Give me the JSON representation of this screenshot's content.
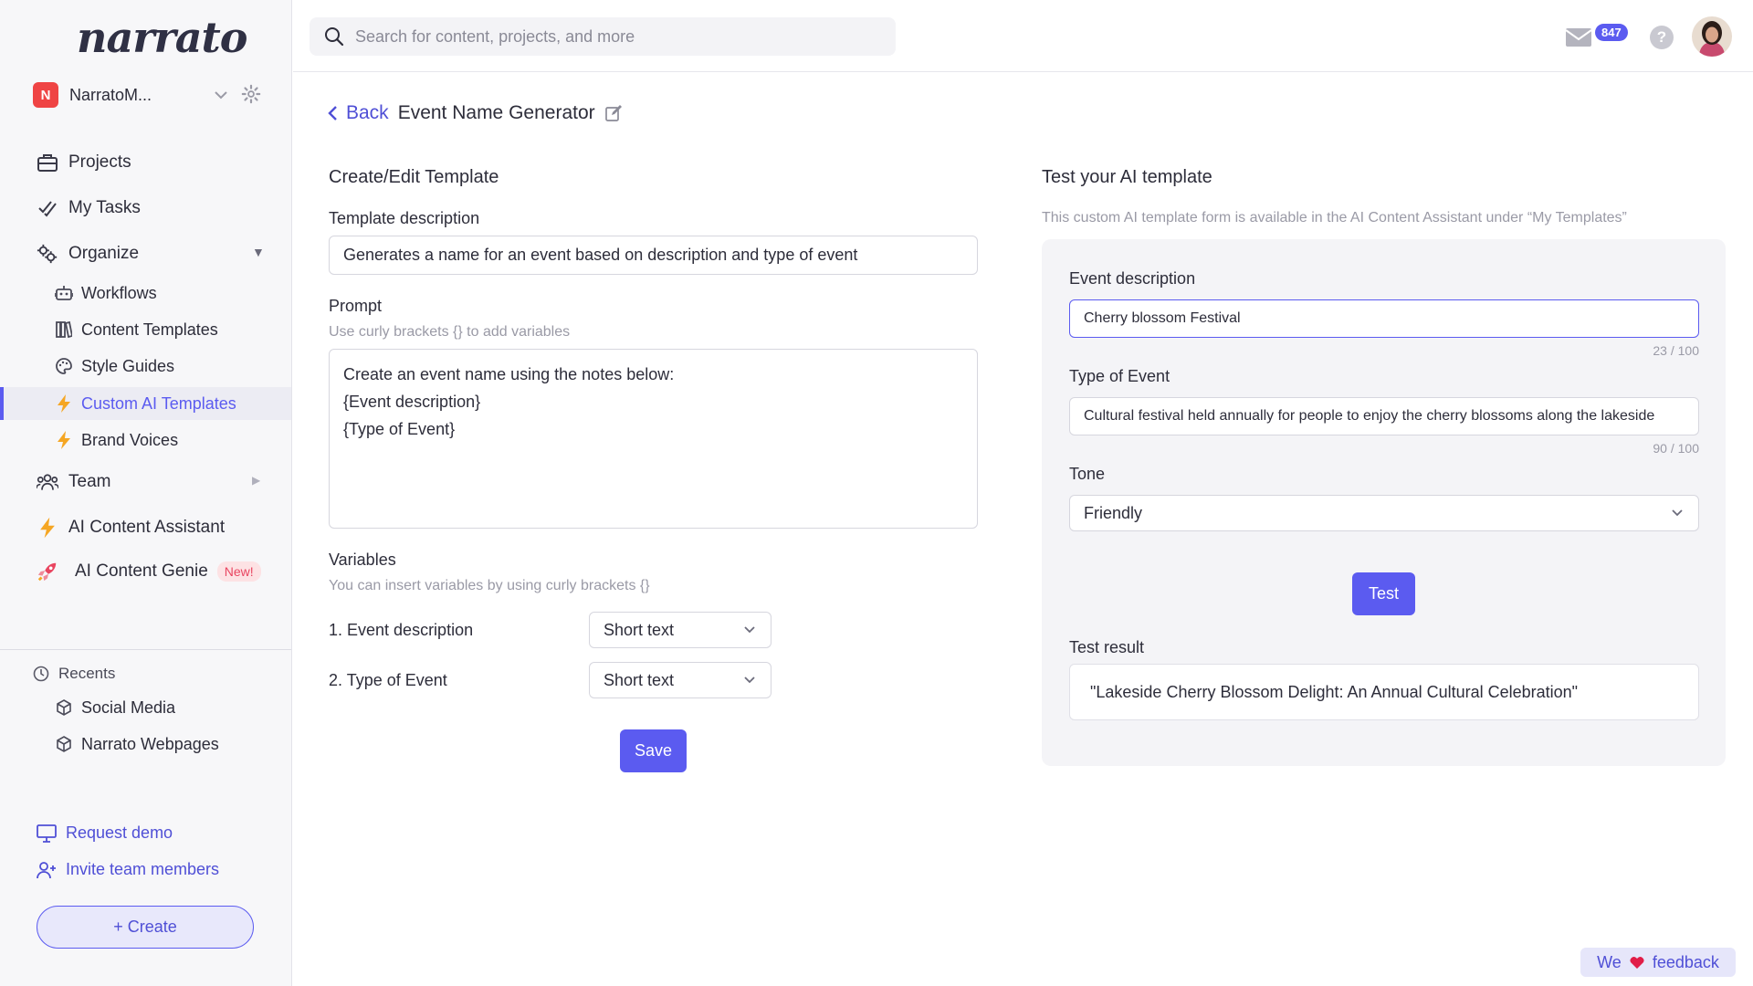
{
  "app": {
    "logo_text": "narrato"
  },
  "workspace": {
    "initial": "N",
    "name": "NarratoM..."
  },
  "sidebar": {
    "nav": [
      {
        "label": "Projects",
        "icon": "briefcase-icon"
      },
      {
        "label": "My Tasks",
        "icon": "checkmarks-icon"
      },
      {
        "label": "Organize",
        "icon": "gears-icon"
      }
    ],
    "organize_items": [
      {
        "label": "Workflows",
        "icon": "robot-icon"
      },
      {
        "label": "Content Templates",
        "icon": "books-icon"
      },
      {
        "label": "Style Guides",
        "icon": "palette-icon"
      },
      {
        "label": "Custom AI Templates",
        "icon": "bolt-icon",
        "active": true
      },
      {
        "label": "Brand Voices",
        "icon": "bolt-icon"
      }
    ],
    "team": {
      "label": "Team",
      "icon": "people-icon"
    },
    "ai_assistant": {
      "label": "AI Content Assistant",
      "icon": "bolt-icon"
    },
    "ai_genie": {
      "label": "AI Content Genie",
      "badge": "New!",
      "icon": "rocket-icon"
    },
    "recents": {
      "title": "Recents",
      "items": [
        {
          "label": "Social Media",
          "icon": "cube-icon"
        },
        {
          "label": "Narrato Webpages",
          "icon": "cube-icon"
        }
      ]
    },
    "request_demo": "Request demo",
    "invite": "Invite team members",
    "create": "+ Create"
  },
  "topbar": {
    "search_placeholder": "Search for content, projects, and more",
    "mail_count": "847",
    "help": "?"
  },
  "page": {
    "back": "Back",
    "title": "Event Name Generator"
  },
  "editor": {
    "section_title": "Create/Edit Template",
    "template_description_label": "Template description",
    "template_description_value": "Generates a name for an event based on description and type of event",
    "prompt_label": "Prompt",
    "prompt_hint": "Use curly brackets {} to add variables",
    "prompt_value": "Create an event name using the notes below:\n{Event description}\n{Type of Event}",
    "variables_label": "Variables",
    "variables_hint": "You can insert variables by using curly brackets {}",
    "variables": [
      {
        "label": "1. Event description",
        "type": "Short text"
      },
      {
        "label": "2. Type of Event",
        "type": "Short text"
      }
    ],
    "save": "Save"
  },
  "tester": {
    "section_title": "Test your AI template",
    "hint": "This custom AI template form is available in the AI Content Assistant under “My Templates”",
    "event_description_label": "Event description",
    "event_description_value": "Cherry blossom Festival",
    "event_description_count": "23 / 100",
    "type_label": "Type of Event",
    "type_value": "Cultural festival held annually for people to enjoy the cherry blossoms along the lakeside",
    "type_count": "90 / 100",
    "tone_label": "Tone",
    "tone_value": "Friendly",
    "test_button": "Test",
    "result_label": "Test result",
    "result_value": "\"Lakeside Cherry Blossom Delight: An Annual Cultural Celebration\""
  },
  "feedback": {
    "before": "We",
    "after": "feedback"
  },
  "colors": {
    "accent": "#5b5bf0",
    "badge_red": "#ef4444",
    "heart": "#e11d48"
  }
}
